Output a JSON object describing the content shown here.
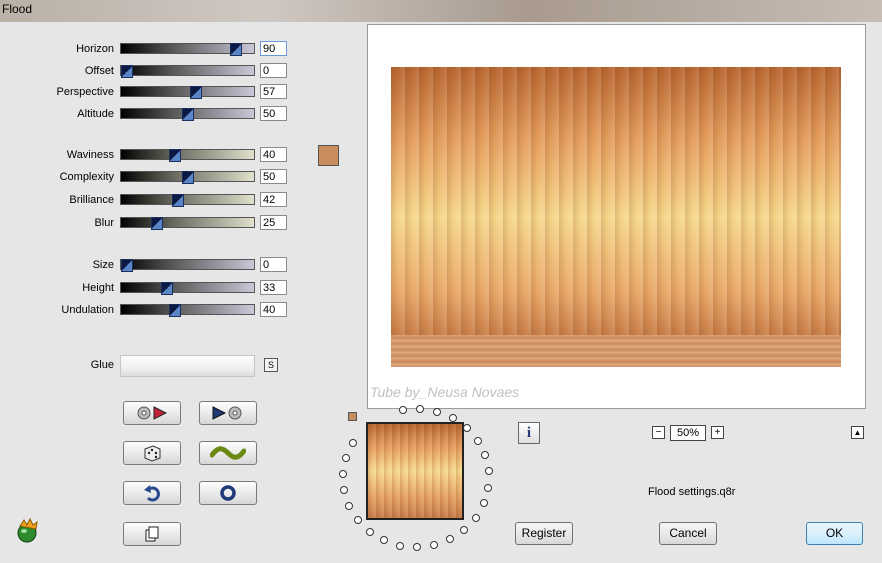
{
  "window": {
    "title": "Flood"
  },
  "sliders": [
    {
      "label": "Horizon",
      "value": "90",
      "fraction": 0.9,
      "track_style": "dark"
    },
    {
      "label": "Offset",
      "value": "0",
      "fraction": 0.0,
      "track_style": "dark"
    },
    {
      "label": "Perspective",
      "value": "57",
      "fraction": 0.57,
      "track_style": "dark"
    },
    {
      "label": "Altitude",
      "value": "50",
      "fraction": 0.5,
      "track_style": "dark"
    },
    {
      "label": "Waviness",
      "value": "40",
      "fraction": 0.4,
      "track_style": "light"
    },
    {
      "label": "Complexity",
      "value": "50",
      "fraction": 0.5,
      "track_style": "light"
    },
    {
      "label": "Brilliance",
      "value": "42",
      "fraction": 0.42,
      "track_style": "light"
    },
    {
      "label": "Blur",
      "value": "25",
      "fraction": 0.25,
      "track_style": "light"
    },
    {
      "label": "Size",
      "value": "0",
      "fraction": 0.0,
      "track_style": "dark"
    },
    {
      "label": "Height",
      "value": "33",
      "fraction": 0.33,
      "track_style": "dark"
    },
    {
      "label": "Undulation",
      "value": "40",
      "fraction": 0.4,
      "track_style": "dark"
    }
  ],
  "color_swatch": "#c98e5d",
  "glue": {
    "label": "Glue",
    "toggle_label": "S"
  },
  "tool_buttons": [
    {
      "name": "randomize-forward",
      "icon": "disc-play-icon"
    },
    {
      "name": "play-disc",
      "icon": "play-disc-icon"
    },
    {
      "name": "random",
      "icon": "dice-icon"
    },
    {
      "name": "wave",
      "icon": "wave-icon"
    },
    {
      "name": "undo",
      "icon": "undo-arrow-icon"
    },
    {
      "name": "reset",
      "icon": "ring-icon"
    },
    {
      "name": "copy",
      "icon": "copy-pages-icon"
    }
  ],
  "preview": {
    "watermark": "Tube by_Neusa Novaes",
    "zoom": "50%",
    "zoom_minus": "−",
    "zoom_plus": "+",
    "up_arrow": "▲",
    "info": "i"
  },
  "settings_file": "Flood settings.q8r",
  "buttons": {
    "register": "Register",
    "cancel": "Cancel",
    "ok": "OK"
  }
}
